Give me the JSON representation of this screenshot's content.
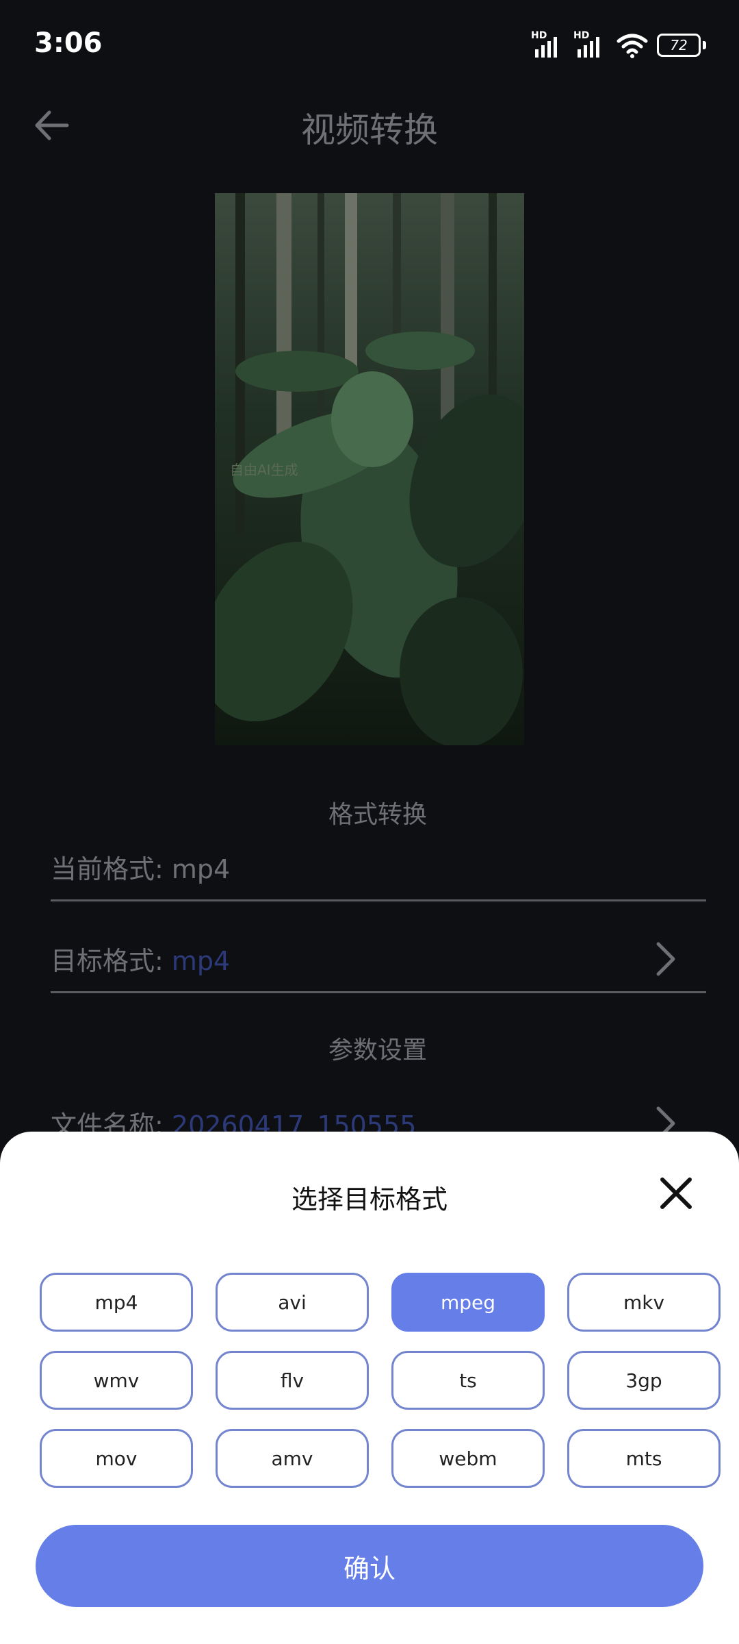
{
  "status_bar": {
    "time": "3:06",
    "battery": "72",
    "hd_label": "HD"
  },
  "header": {
    "title": "视频转换",
    "back_icon": "arrow-left-icon"
  },
  "video": {
    "watermark": "自由AI生成"
  },
  "format_section": {
    "title": "格式转换",
    "current_label": "当前格式:",
    "current_value": "mp4",
    "target_label": "目标格式:",
    "target_value": "mp4"
  },
  "params_section": {
    "title": "参数设置",
    "filename_label": "文件名称:",
    "filename_value": "20260417_150555"
  },
  "sheet": {
    "title": "选择目标格式",
    "formats": [
      "mp4",
      "avi",
      "mpeg",
      "mkv",
      "wmv",
      "flv",
      "ts",
      "3gp",
      "mov",
      "amv",
      "webm",
      "mts"
    ],
    "selected": "mpeg",
    "confirm_label": "确认"
  },
  "colors": {
    "accent": "#667fe8",
    "border": "#7485cf",
    "link": "#2d3a79"
  }
}
